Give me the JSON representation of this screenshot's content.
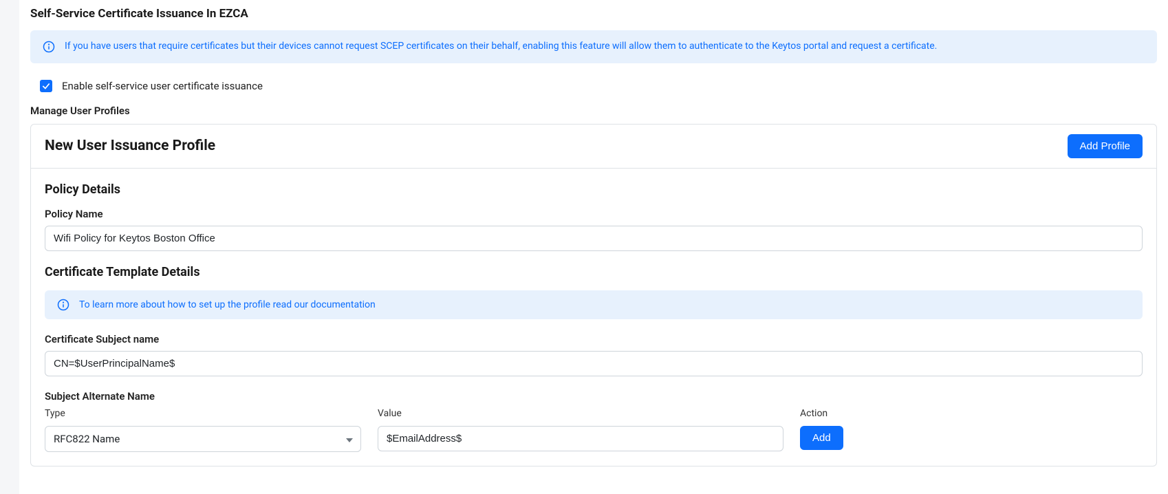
{
  "header": {
    "title": "Self-Service Certificate Issuance In EZCA"
  },
  "topInfo": {
    "text": "If you have users that require certificates but their devices cannot request SCEP certificates on their behalf, enabling this feature will allow them to authenticate to the Keytos portal and request a certificate."
  },
  "enableCheckbox": {
    "checked": true,
    "label": "Enable self-service user certificate issuance"
  },
  "manageProfiles": {
    "label": "Manage User Profiles"
  },
  "profileCard": {
    "title": "New User Issuance Profile",
    "addProfileLabel": "Add Profile"
  },
  "policyDetails": {
    "heading": "Policy Details",
    "policyNameLabel": "Policy Name",
    "policyNameValue": "Wifi Policy for Keytos Boston Office"
  },
  "templateDetails": {
    "heading": "Certificate Template Details",
    "infoText": "To learn more about how to set up the profile read our documentation",
    "subjectNameLabel": "Certificate Subject name",
    "subjectNameValue": "CN=$UserPrincipalName$",
    "sanLabel": "Subject Alternate Name",
    "columns": {
      "type": "Type",
      "value": "Value",
      "action": "Action"
    },
    "sanEntry": {
      "type": "RFC822 Name",
      "value": "$EmailAddress$",
      "addLabel": "Add"
    }
  }
}
